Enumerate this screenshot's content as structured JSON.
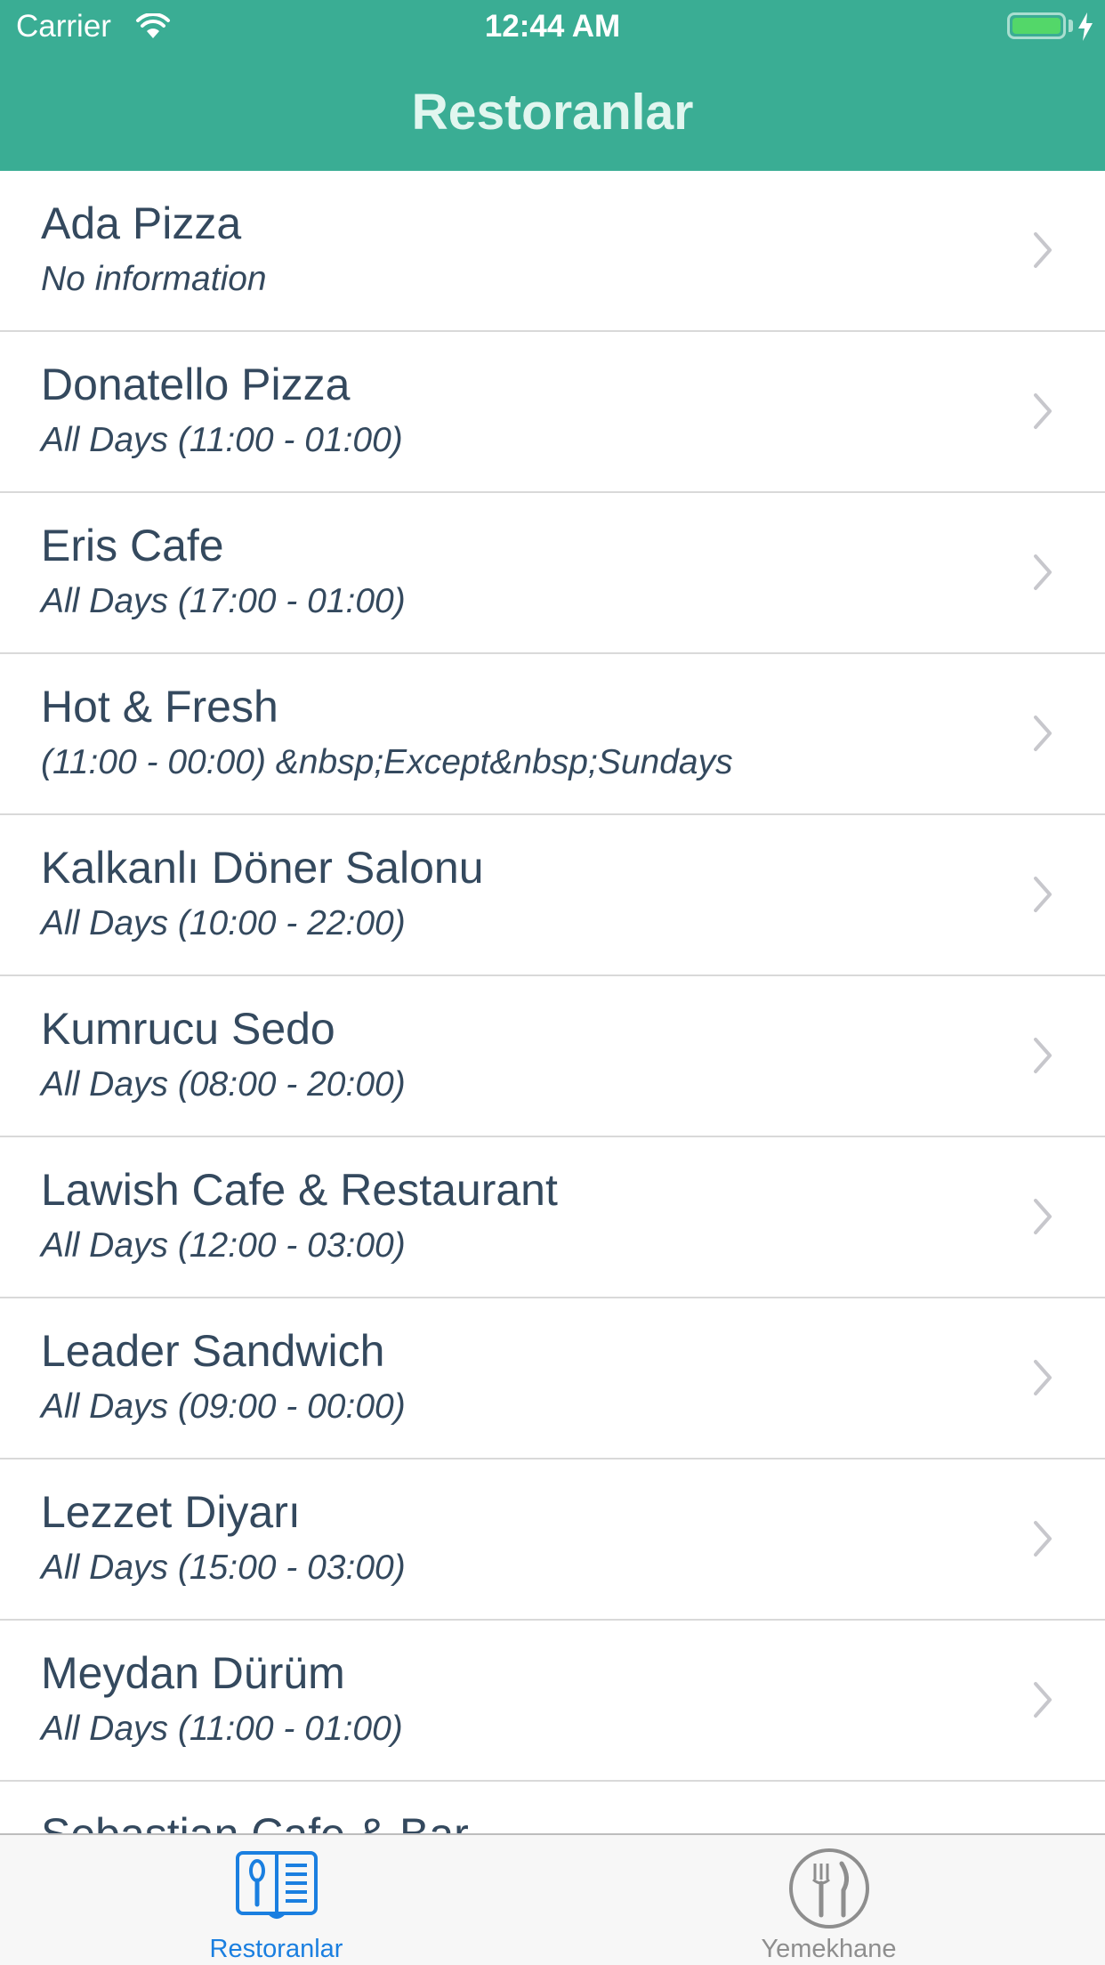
{
  "status_bar": {
    "carrier": "Carrier",
    "time": "12:44 AM"
  },
  "nav": {
    "title": "Restoranlar"
  },
  "restaurants": [
    {
      "name": "Ada Pizza",
      "hours": "No information"
    },
    {
      "name": "Donatello Pizza",
      "hours": "All Days (11:00 - 01:00)"
    },
    {
      "name": "Eris Cafe",
      "hours": "All Days (17:00 - 01:00)"
    },
    {
      "name": "Hot & Fresh",
      "hours": "(11:00 - 00:00) &nbsp;Except&nbsp;Sundays"
    },
    {
      "name": "Kalkanlı Döner Salonu",
      "hours": "All Days (10:00 - 22:00)"
    },
    {
      "name": "Kumrucu Sedo",
      "hours": "All Days (08:00 - 20:00)"
    },
    {
      "name": "Lawish Cafe & Restaurant",
      "hours": "All Days (12:00 - 03:00)"
    },
    {
      "name": "Leader Sandwich",
      "hours": "All Days (09:00 - 00:00)"
    },
    {
      "name": "Lezzet Diyarı",
      "hours": "All Days (15:00 - 03:00)"
    },
    {
      "name": "Meydan Dürüm",
      "hours": "All Days (11:00 - 01:00)"
    },
    {
      "name": "Sebastian Cafe & Bar",
      "hours": ""
    }
  ],
  "tabs": [
    {
      "label": "Restoranlar",
      "icon": "menu-book-icon",
      "selected": true
    },
    {
      "label": "Yemekhane",
      "icon": "fork-knife-icon",
      "selected": false
    }
  ],
  "colors": {
    "header": "#3aad94",
    "tab_active": "#1a7fe0",
    "tab_inactive": "#8e8e8e",
    "text": "#34495e"
  }
}
